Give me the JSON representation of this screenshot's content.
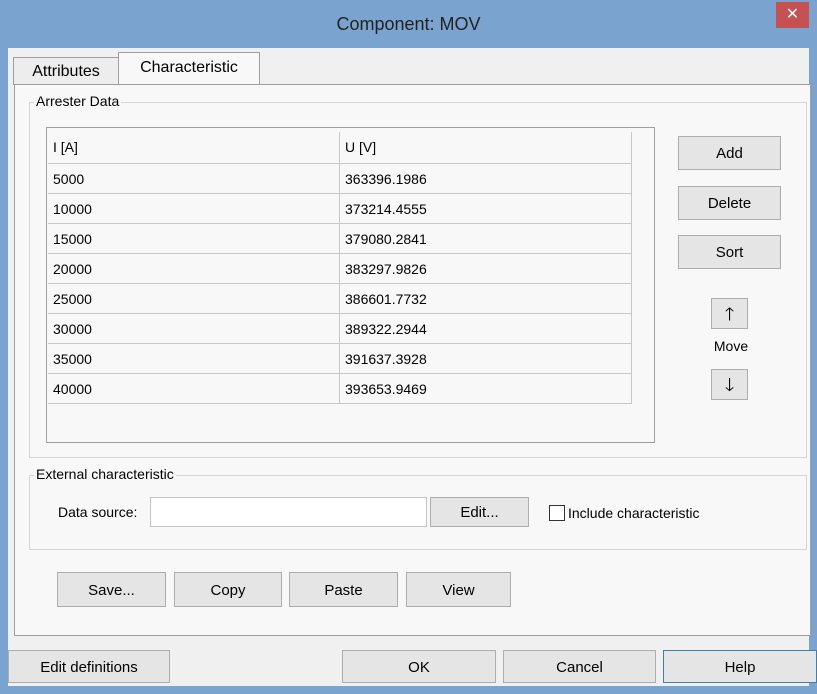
{
  "window": {
    "title": "Component: MOV",
    "close_glyph": "✕"
  },
  "tabs": [
    {
      "label": "Attributes"
    },
    {
      "label": "Characteristic"
    }
  ],
  "arrester": {
    "group_label": "Arrester Data",
    "columns": [
      "I [A]",
      "U [V]"
    ],
    "rows": [
      [
        "5000",
        "363396.1986"
      ],
      [
        "10000",
        "373214.4555"
      ],
      [
        "15000",
        "379080.2841"
      ],
      [
        "20000",
        "383297.9826"
      ],
      [
        "25000",
        "386601.7732"
      ],
      [
        "30000",
        "389322.2944"
      ],
      [
        "35000",
        "391637.3928"
      ],
      [
        "40000",
        "393653.9469"
      ]
    ]
  },
  "side_buttons": {
    "add": "Add",
    "delete": "Delete",
    "sort": "Sort",
    "move_label": "Move",
    "up_icon": "arrow-up-icon",
    "down_icon": "arrow-down-icon",
    "up_glyph": "🡑",
    "down_glyph": "🡓"
  },
  "external": {
    "group_label": "External characteristic",
    "data_source_label": "Data source:",
    "data_source_value": "",
    "edit_button": "Edit...",
    "include_label": "Include characteristic",
    "include_checked": false
  },
  "actions": {
    "save": "Save...",
    "copy": "Copy",
    "paste": "Paste",
    "view": "View"
  },
  "footer": {
    "edit_definitions": "Edit definitions",
    "ok": "OK",
    "cancel": "Cancel",
    "help": "Help"
  }
}
